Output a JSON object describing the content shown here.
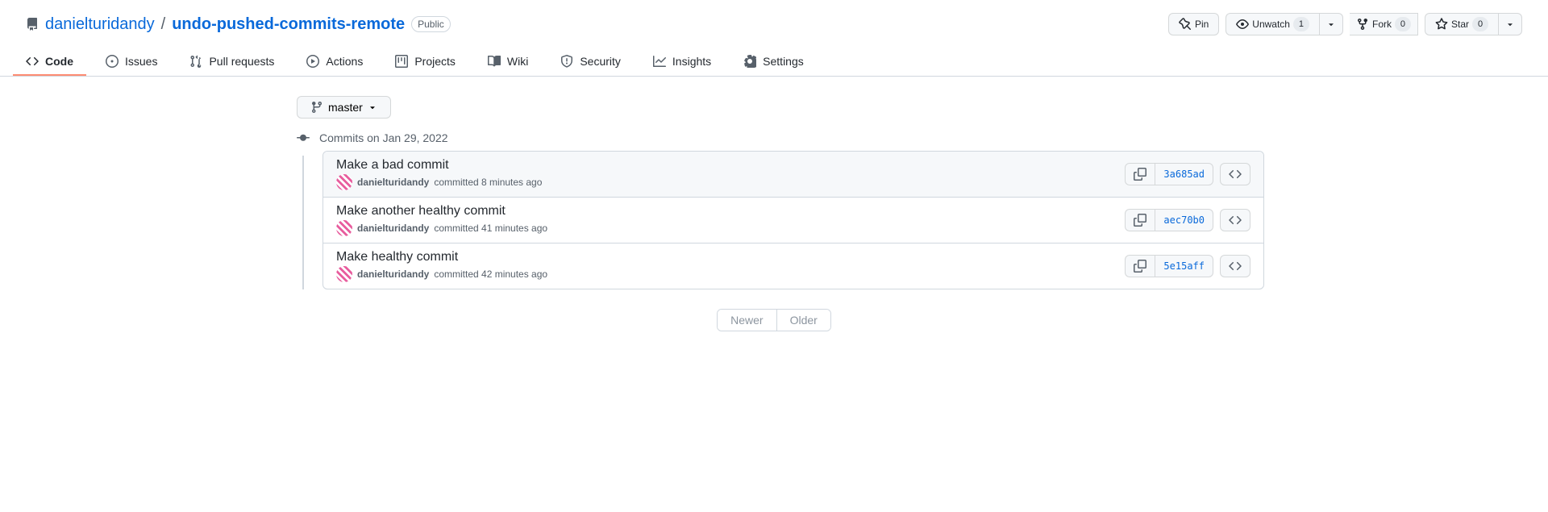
{
  "repo": {
    "owner": "danielturidandy",
    "name": "undo-pushed-commits-remote",
    "visibility": "Public"
  },
  "actions": {
    "pin": "Pin",
    "unwatch": "Unwatch",
    "unwatch_count": "1",
    "fork": "Fork",
    "fork_count": "0",
    "star": "Star",
    "star_count": "0"
  },
  "nav": {
    "code": "Code",
    "issues": "Issues",
    "pull_requests": "Pull requests",
    "actions": "Actions",
    "projects": "Projects",
    "wiki": "Wiki",
    "security": "Security",
    "insights": "Insights",
    "settings": "Settings"
  },
  "branch": "master",
  "commits_date": "Commits on Jan 29, 2022",
  "commits": [
    {
      "title": "Make a bad commit",
      "author": "danielturidandy",
      "committed": "committed 8 minutes ago",
      "sha": "3a685ad"
    },
    {
      "title": "Make another healthy commit",
      "author": "danielturidandy",
      "committed": "committed 41 minutes ago",
      "sha": "aec70b0"
    },
    {
      "title": "Make healthy commit",
      "author": "danielturidandy",
      "committed": "committed 42 minutes ago",
      "sha": "5e15aff"
    }
  ],
  "pagination": {
    "newer": "Newer",
    "older": "Older"
  }
}
